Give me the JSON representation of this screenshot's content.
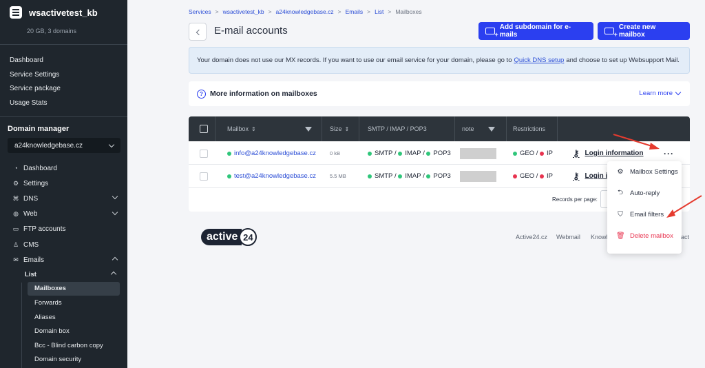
{
  "sidebar": {
    "account_name": "wsactivetest_kb",
    "account_sub": "20 GB, 3 domains",
    "top_links": [
      "Dashboard",
      "Service Settings",
      "Service package",
      "Usage Stats"
    ],
    "domain_manager_title": "Domain manager",
    "domain_select": "a24knowledgebase.cz",
    "nav": [
      {
        "label": "Dashboard",
        "icon": "dashboard-icon"
      },
      {
        "label": "Settings",
        "icon": "gear-icon"
      },
      {
        "label": "DNS",
        "icon": "dns-icon"
      },
      {
        "label": "Web",
        "icon": "globe-icon"
      },
      {
        "label": "FTP accounts",
        "icon": "folder-icon"
      },
      {
        "label": "CMS",
        "icon": "cms-icon"
      },
      {
        "label": "Emails",
        "icon": "mail-icon"
      }
    ],
    "list_label": "List",
    "sub_items": [
      "Mailboxes",
      "Forwards",
      "Aliases",
      "Domain box",
      "Bcc - Blind carbon copy",
      "Domain security"
    ]
  },
  "breadcrumbs": [
    "Services",
    "wsactivetest_kb",
    "a24knowledgebase.cz",
    "Emails",
    "List",
    "Mailboxes"
  ],
  "page_title": "E-mail accounts",
  "buttons": {
    "add_subdomain": "Add subdomain for e-mails",
    "create_mailbox": "Create new mailbox"
  },
  "info": {
    "text_before": "Your domain does not use our MX records. If you want to use our email service for your domain, please go to",
    "link": "Quick DNS setup",
    "text_after": "and choose to set up Websupport Mail."
  },
  "more_info": {
    "title": "More information on mailboxes",
    "learn_more": "Learn more"
  },
  "table": {
    "headers": {
      "mailbox": "Mailbox",
      "size": "Size",
      "protocols": "SMTP / IMAP / POP3",
      "note": "note",
      "restrictions": "Restrictions"
    },
    "sort_glyph": "⇕",
    "rows": [
      {
        "mailbox": "info@a24knowledgebase.cz",
        "size": "0 kB",
        "smtp": "SMTP",
        "imap": "IMAP",
        "pop3": "POP3",
        "geo": "GEO",
        "ip": "IP",
        "login": "Login information"
      },
      {
        "mailbox": "test@a24knowledgebase.cz",
        "size": "5.5 MB",
        "smtp": "SMTP",
        "imap": "IMAP",
        "pop3": "POP3",
        "geo": "GEO",
        "ip": "IP",
        "login": "Login i"
      }
    ],
    "slash": "/",
    "records_per_page": "Records per page:",
    "more_dots": "···"
  },
  "context_menu": [
    {
      "label": "Mailbox Settings",
      "icon": "gear-icon"
    },
    {
      "label": "Auto-reply",
      "icon": "auto-reply-icon"
    },
    {
      "label": "Email filters",
      "icon": "filter-icon"
    },
    {
      "label": "Delete mailbox",
      "icon": "trash-icon"
    }
  ],
  "footer": {
    "logo_text": "active",
    "logo_num": "24",
    "links": [
      "Active24.cz",
      "Webmail",
      "Knowl",
      "act"
    ]
  },
  "colors": {
    "primary": "#2b3ff0",
    "sidebar": "#1f262d",
    "green": "#2fc67a",
    "red": "#e8334f",
    "arrow": "#e53b2f"
  }
}
